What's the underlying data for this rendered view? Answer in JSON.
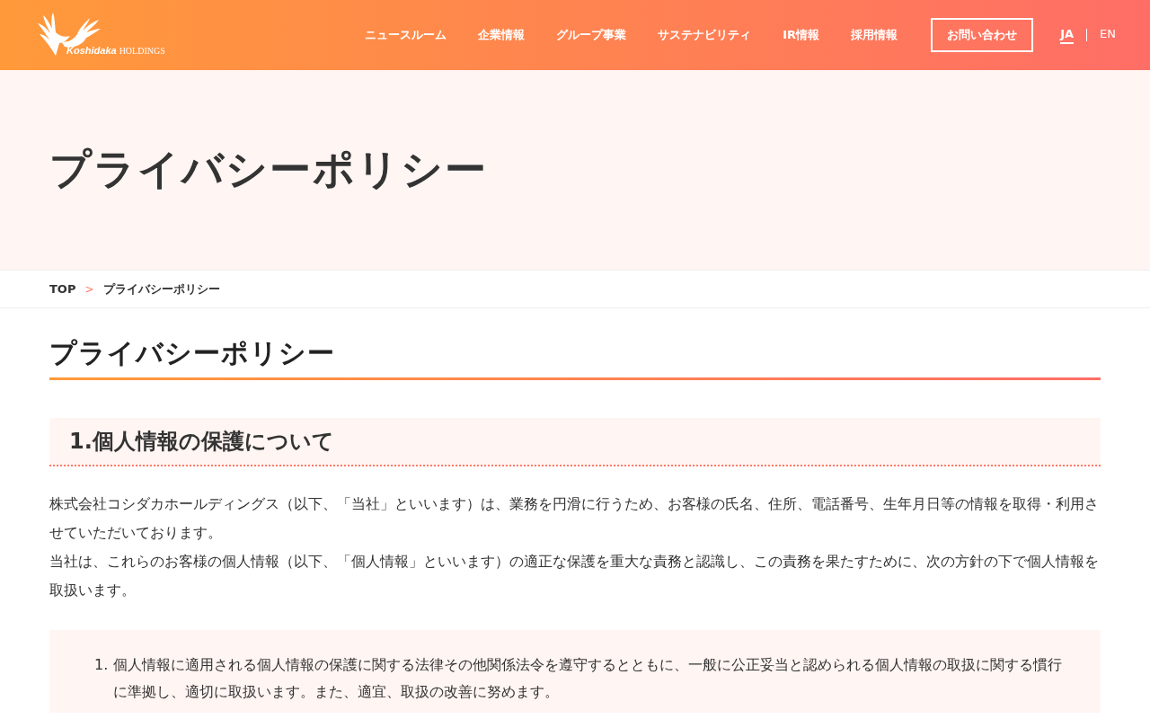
{
  "header": {
    "logo": {
      "brand": "Koshidaka",
      "suffix": "HOLDINGS"
    },
    "nav": [
      {
        "label": "ニュースルーム"
      },
      {
        "label": "企業情報"
      },
      {
        "label": "グループ事業"
      },
      {
        "label": "サステナビリティ"
      },
      {
        "label": "IR情報"
      },
      {
        "label": "採用情報"
      }
    ],
    "contact_button": "お問い合わせ",
    "languages": [
      {
        "label": "JA",
        "selected": true
      },
      {
        "label": "EN",
        "selected": false
      }
    ]
  },
  "hero": {
    "title": "プライバシーポリシー"
  },
  "breadcrumb": [
    {
      "label": "TOP"
    },
    {
      "label": "プライバシーポリシー"
    }
  ],
  "breadcrumb_separator": ">",
  "page_heading": "プライバシーポリシー",
  "sections": [
    {
      "heading": "1.個人情報の保護について",
      "paragraphs": [
        "株式会社コシダカホールディングス（以下、「当社」といいます）は、業務を円滑に行うため、お客様の氏名、住所、電話番号、生年月日等の情報を取得・利用させていただいております。",
        "当社は、これらのお客様の個人情報（以下、「個人情報」といいます）の適正な保護を重大な責務と認識し、この責務を果たすために、次の方針の下で個人情報を取扱います。"
      ],
      "policy_items": [
        {
          "number": "1.",
          "text": "個人情報に適用される個人情報の保護に関する法律その他関係法令を遵守するとともに、一般に公正妥当と認められる個人情報の取扱に関する慣行に準拠し、適切に取扱います。また、適宜、取扱の改善に努めます。"
        }
      ]
    }
  ]
}
